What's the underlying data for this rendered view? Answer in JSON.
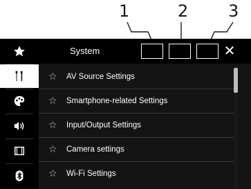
{
  "callouts": [
    "1",
    "2",
    "3"
  ],
  "header": {
    "title": "System",
    "close_icon": "close-icon"
  },
  "sidebar": {
    "items": [
      {
        "icon": "favorites-star-icon"
      },
      {
        "icon": "tools-icon",
        "active": true
      },
      {
        "icon": "theme-palette-icon"
      },
      {
        "icon": "sound-speaker-icon"
      },
      {
        "icon": "video-film-icon"
      },
      {
        "icon": "bluetooth-icon"
      }
    ]
  },
  "menu": {
    "items": [
      {
        "label": "AV Source Settings"
      },
      {
        "label": "Smartphone-related Settings"
      },
      {
        "label": "Input/Output Settings"
      },
      {
        "label": "Camera settings"
      },
      {
        "label": "Wi-Fi Settings"
      }
    ]
  },
  "colors": {
    "background": "#0a0a0a",
    "active_tab": "#ffffff",
    "text": "#ffffff"
  }
}
